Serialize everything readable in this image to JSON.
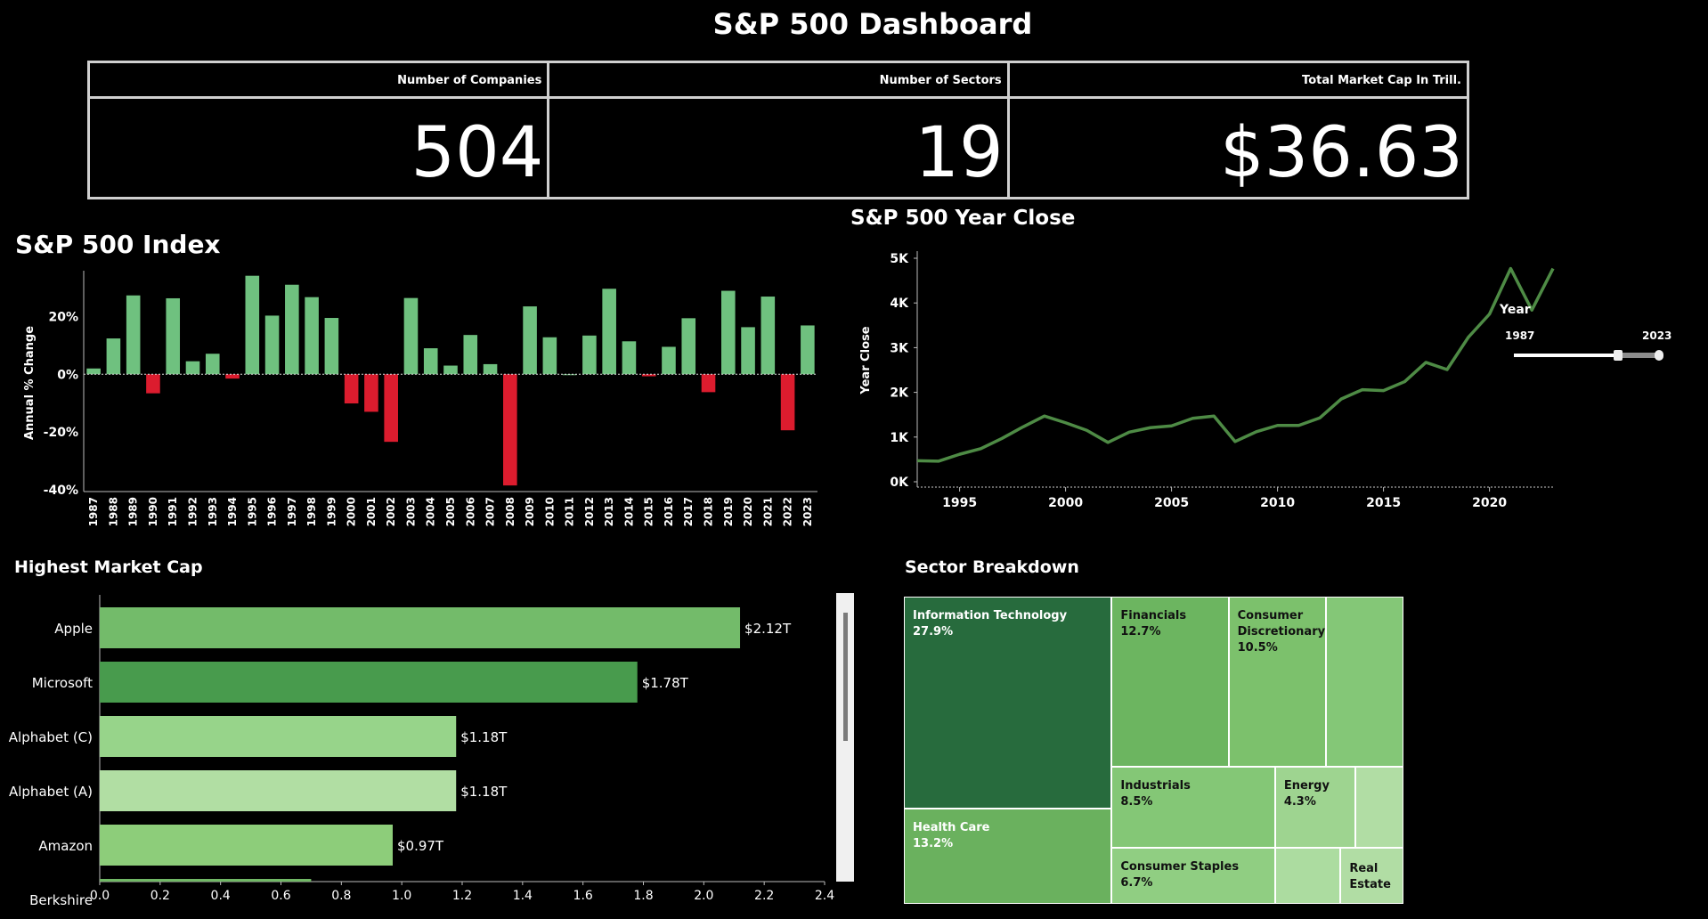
{
  "dashboard": {
    "title": "S&P 500 Dashboard"
  },
  "kpis": [
    {
      "label": "Number of Companies",
      "value": "504"
    },
    {
      "label": "Number of Sectors",
      "value": "19"
    },
    {
      "label": "Total Market Cap In Trill.",
      "value": "$36.63"
    }
  ],
  "sections": {
    "index_title": "S&P 500 Index",
    "close_title": "S&P 500 Year Close",
    "cap_title": "Highest Market Cap",
    "sector_title": "Sector Breakdown"
  },
  "year_filter": {
    "label": "Year",
    "start": "1987",
    "end": "2023",
    "range_fraction": [
      0.0,
      1.0
    ]
  },
  "colors": {
    "positive": "#6fc17f",
    "negative": "#dc1c2e",
    "line": "#4e8b45",
    "bar_greens": [
      "#73bb6a",
      "#489b4d",
      "#97d48a",
      "#b1dea3",
      "#8dcd7a",
      "#71b866"
    ]
  },
  "chart_data": [
    {
      "id": "index",
      "type": "bar",
      "title": "S&P 500 Index",
      "ylabel": "Annual % Change",
      "xlabel": "",
      "ylim": [
        -40,
        34
      ],
      "yticks": [
        20,
        0,
        -20,
        -40
      ],
      "ytick_labels": [
        "20%",
        "0%",
        "-20%",
        "-40%"
      ],
      "categories": [
        "1987",
        "1988",
        "1989",
        "1990",
        "1991",
        "1992",
        "1993",
        "1994",
        "1995",
        "1996",
        "1997",
        "1998",
        "1999",
        "2000",
        "2001",
        "2002",
        "2003",
        "2004",
        "2005",
        "2006",
        "2007",
        "2008",
        "2009",
        "2010",
        "2011",
        "2012",
        "2013",
        "2014",
        "2015",
        "2016",
        "2017",
        "2018",
        "2019",
        "2020",
        "2021",
        "2022",
        "2023"
      ],
      "values": [
        2,
        12.4,
        27.3,
        -6.6,
        26.3,
        4.5,
        7.1,
        -1.5,
        34.1,
        20.3,
        31.0,
        26.7,
        19.5,
        -10.1,
        -13.0,
        -23.4,
        26.4,
        9.0,
        3.0,
        13.6,
        3.5,
        -38.5,
        23.5,
        12.8,
        0,
        13.4,
        29.6,
        11.4,
        -0.7,
        9.5,
        19.4,
        -6.2,
        28.9,
        16.3,
        26.9,
        -19.4,
        16.9
      ]
    },
    {
      "id": "close",
      "type": "line",
      "title": "S&P 500 Year Close",
      "ylabel": "Year Close",
      "xlabel": "",
      "ylim": [
        0,
        5000
      ],
      "yticks": [
        0,
        1000,
        2000,
        3000,
        4000,
        5000
      ],
      "ytick_labels": [
        "0K",
        "1K",
        "2K",
        "3K",
        "4K",
        "5K"
      ],
      "xlim": [
        1993,
        2023
      ],
      "xticks": [
        1995,
        2000,
        2005,
        2010,
        2015,
        2020
      ],
      "x": [
        1993,
        1994,
        1995,
        1996,
        1997,
        1998,
        1999,
        2000,
        2001,
        2002,
        2003,
        2004,
        2005,
        2006,
        2007,
        2008,
        2009,
        2010,
        2011,
        2012,
        2013,
        2014,
        2015,
        2016,
        2017,
        2018,
        2019,
        2020,
        2021,
        2022,
        2023
      ],
      "values": [
        470,
        460,
        615,
        740,
        970,
        1230,
        1470,
        1320,
        1150,
        880,
        1110,
        1210,
        1250,
        1420,
        1470,
        900,
        1120,
        1260,
        1260,
        1430,
        1850,
        2060,
        2040,
        2240,
        2670,
        2510,
        3230,
        3750,
        4770,
        3840,
        4770
      ]
    },
    {
      "id": "cap",
      "type": "bar",
      "orientation": "horizontal",
      "title": "Highest Market Cap",
      "xlabel": "",
      "ylabel": "",
      "xlim": [
        0,
        2.4
      ],
      "xticks": [
        0.0,
        0.2,
        0.4,
        0.6,
        0.8,
        1.0,
        1.2,
        1.4,
        1.6,
        1.8,
        2.0,
        2.2,
        2.4
      ],
      "xtick_labels": [
        "0.0",
        "0.2",
        "0.4",
        "0.6",
        "0.8",
        "1.0",
        "1.2",
        "1.4",
        "1.6",
        "1.8",
        "2.0",
        "2.2",
        "2.4"
      ],
      "categories": [
        "Apple",
        "Microsoft",
        "Alphabet (C)",
        "Alphabet (A)",
        "Amazon",
        "Berkshire"
      ],
      "values": [
        2.12,
        1.78,
        1.18,
        1.18,
        0.97,
        0.7
      ],
      "labels": [
        "$2.12T",
        "$1.78T",
        "$1.18T",
        "$1.18T",
        "$0.97T",
        ""
      ]
    },
    {
      "id": "sector",
      "type": "treemap",
      "title": "Sector Breakdown",
      "items": [
        {
          "name": "Information Technology",
          "pct": "27.9%",
          "color": "#276b3d"
        },
        {
          "name": "Health Care",
          "pct": "13.2%",
          "color": "#6ab15e"
        },
        {
          "name": "Financials",
          "pct": "12.7%",
          "color": "#6cb560"
        },
        {
          "name": "Consumer\nDiscretionary",
          "pct": "10.5%",
          "color": "#7cc16c"
        },
        {
          "name": "",
          "pct": "",
          "color": "#84c777"
        },
        {
          "name": "Industrials",
          "pct": "8.5%",
          "color": "#84c776"
        },
        {
          "name": "Energy",
          "pct": "4.3%",
          "color": "#9ed490"
        },
        {
          "name": "",
          "pct": "",
          "color": "#b1dda4"
        },
        {
          "name": "Consumer Staples",
          "pct": "6.7%",
          "color": "#90ce82"
        },
        {
          "name": "",
          "pct": "",
          "color": "#acdca0"
        },
        {
          "name": "Real\nEstate",
          "pct": "",
          "color": "#b1dda4"
        }
      ]
    }
  ]
}
